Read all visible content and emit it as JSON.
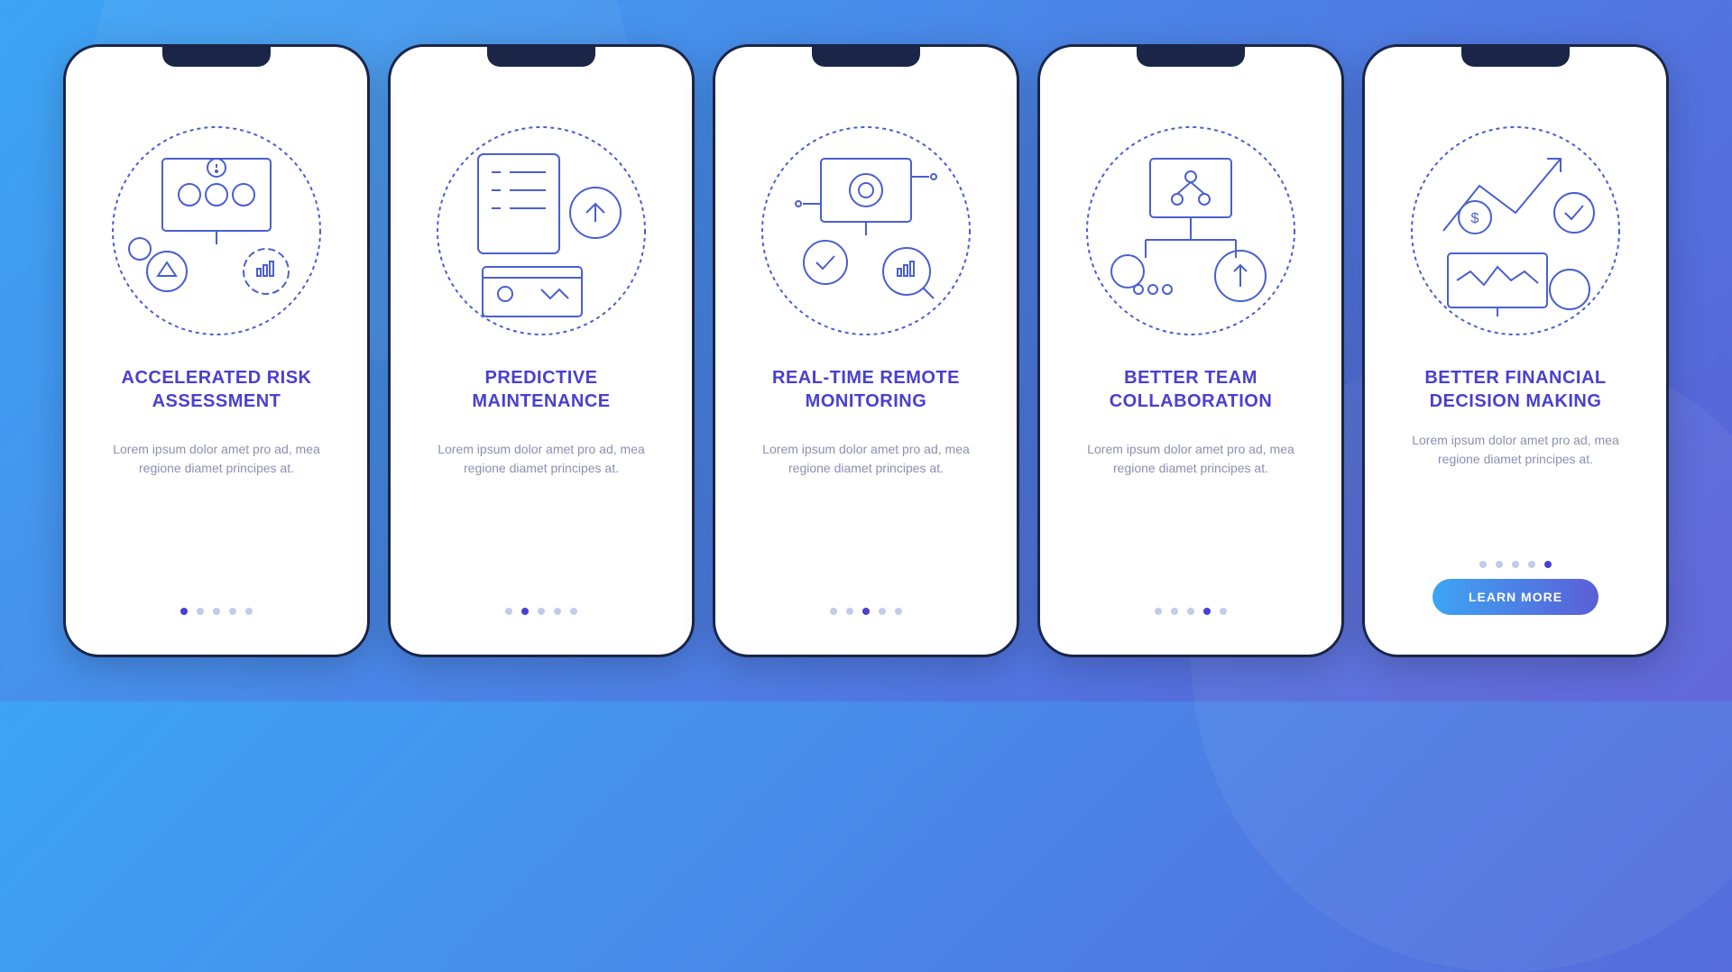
{
  "screens": [
    {
      "title": "ACCELERATED RISK ASSESSMENT",
      "body": "Lorem ipsum dolor amet pro ad, mea regione diamet principes at.",
      "active": 0
    },
    {
      "title": "PREDICTIVE MAINTENANCE",
      "body": "Lorem ipsum dolor amet pro ad, mea regione diamet principes at.",
      "active": 1
    },
    {
      "title": "REAL-TIME REMOTE MONITORING",
      "body": "Lorem ipsum dolor amet pro ad, mea regione diamet principes at.",
      "active": 2
    },
    {
      "title": "BETTER TEAM COLLABORATION",
      "body": "Lorem ipsum dolor amet pro ad, mea regione diamet principes at.",
      "active": 3
    },
    {
      "title": "BETTER FINANCIAL DECISION MAKING",
      "body": "Lorem ipsum dolor amet pro ad, mea regione diamet principes at.",
      "active": 4
    }
  ],
  "cta_label": "LEARN MORE",
  "dot_count": 5
}
